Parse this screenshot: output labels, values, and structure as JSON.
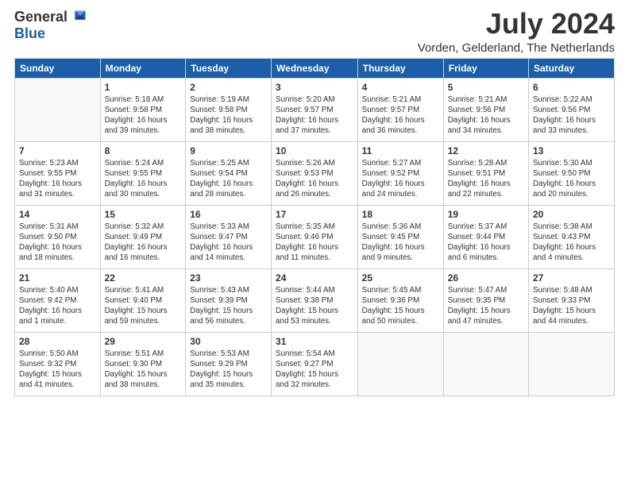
{
  "logo": {
    "general": "General",
    "blue": "Blue"
  },
  "title": "July 2024",
  "location": "Vorden, Gelderland, The Netherlands",
  "weekdays": [
    "Sunday",
    "Monday",
    "Tuesday",
    "Wednesday",
    "Thursday",
    "Friday",
    "Saturday"
  ],
  "weeks": [
    [
      {
        "day": "",
        "info": ""
      },
      {
        "day": "1",
        "info": "Sunrise: 5:18 AM\nSunset: 9:58 PM\nDaylight: 16 hours\nand 39 minutes."
      },
      {
        "day": "2",
        "info": "Sunrise: 5:19 AM\nSunset: 9:58 PM\nDaylight: 16 hours\nand 38 minutes."
      },
      {
        "day": "3",
        "info": "Sunrise: 5:20 AM\nSunset: 9:57 PM\nDaylight: 16 hours\nand 37 minutes."
      },
      {
        "day": "4",
        "info": "Sunrise: 5:21 AM\nSunset: 9:57 PM\nDaylight: 16 hours\nand 36 minutes."
      },
      {
        "day": "5",
        "info": "Sunrise: 5:21 AM\nSunset: 9:56 PM\nDaylight: 16 hours\nand 34 minutes."
      },
      {
        "day": "6",
        "info": "Sunrise: 5:22 AM\nSunset: 9:56 PM\nDaylight: 16 hours\nand 33 minutes."
      }
    ],
    [
      {
        "day": "7",
        "info": "Sunrise: 5:23 AM\nSunset: 9:55 PM\nDaylight: 16 hours\nand 31 minutes."
      },
      {
        "day": "8",
        "info": "Sunrise: 5:24 AM\nSunset: 9:55 PM\nDaylight: 16 hours\nand 30 minutes."
      },
      {
        "day": "9",
        "info": "Sunrise: 5:25 AM\nSunset: 9:54 PM\nDaylight: 16 hours\nand 28 minutes."
      },
      {
        "day": "10",
        "info": "Sunrise: 5:26 AM\nSunset: 9:53 PM\nDaylight: 16 hours\nand 26 minutes."
      },
      {
        "day": "11",
        "info": "Sunrise: 5:27 AM\nSunset: 9:52 PM\nDaylight: 16 hours\nand 24 minutes."
      },
      {
        "day": "12",
        "info": "Sunrise: 5:28 AM\nSunset: 9:51 PM\nDaylight: 16 hours\nand 22 minutes."
      },
      {
        "day": "13",
        "info": "Sunrise: 5:30 AM\nSunset: 9:50 PM\nDaylight: 16 hours\nand 20 minutes."
      }
    ],
    [
      {
        "day": "14",
        "info": "Sunrise: 5:31 AM\nSunset: 9:50 PM\nDaylight: 16 hours\nand 18 minutes."
      },
      {
        "day": "15",
        "info": "Sunrise: 5:32 AM\nSunset: 9:49 PM\nDaylight: 16 hours\nand 16 minutes."
      },
      {
        "day": "16",
        "info": "Sunrise: 5:33 AM\nSunset: 9:47 PM\nDaylight: 16 hours\nand 14 minutes."
      },
      {
        "day": "17",
        "info": "Sunrise: 5:35 AM\nSunset: 9:46 PM\nDaylight: 16 hours\nand 11 minutes."
      },
      {
        "day": "18",
        "info": "Sunrise: 5:36 AM\nSunset: 9:45 PM\nDaylight: 16 hours\nand 9 minutes."
      },
      {
        "day": "19",
        "info": "Sunrise: 5:37 AM\nSunset: 9:44 PM\nDaylight: 16 hours\nand 6 minutes."
      },
      {
        "day": "20",
        "info": "Sunrise: 5:38 AM\nSunset: 9:43 PM\nDaylight: 16 hours\nand 4 minutes."
      }
    ],
    [
      {
        "day": "21",
        "info": "Sunrise: 5:40 AM\nSunset: 9:42 PM\nDaylight: 16 hours\nand 1 minute."
      },
      {
        "day": "22",
        "info": "Sunrise: 5:41 AM\nSunset: 9:40 PM\nDaylight: 15 hours\nand 59 minutes."
      },
      {
        "day": "23",
        "info": "Sunrise: 5:43 AM\nSunset: 9:39 PM\nDaylight: 15 hours\nand 56 minutes."
      },
      {
        "day": "24",
        "info": "Sunrise: 5:44 AM\nSunset: 9:38 PM\nDaylight: 15 hours\nand 53 minutes."
      },
      {
        "day": "25",
        "info": "Sunrise: 5:45 AM\nSunset: 9:36 PM\nDaylight: 15 hours\nand 50 minutes."
      },
      {
        "day": "26",
        "info": "Sunrise: 5:47 AM\nSunset: 9:35 PM\nDaylight: 15 hours\nand 47 minutes."
      },
      {
        "day": "27",
        "info": "Sunrise: 5:48 AM\nSunset: 9:33 PM\nDaylight: 15 hours\nand 44 minutes."
      }
    ],
    [
      {
        "day": "28",
        "info": "Sunrise: 5:50 AM\nSunset: 9:32 PM\nDaylight: 15 hours\nand 41 minutes."
      },
      {
        "day": "29",
        "info": "Sunrise: 5:51 AM\nSunset: 9:30 PM\nDaylight: 15 hours\nand 38 minutes."
      },
      {
        "day": "30",
        "info": "Sunrise: 5:53 AM\nSunset: 9:29 PM\nDaylight: 15 hours\nand 35 minutes."
      },
      {
        "day": "31",
        "info": "Sunrise: 5:54 AM\nSunset: 9:27 PM\nDaylight: 15 hours\nand 32 minutes."
      },
      {
        "day": "",
        "info": ""
      },
      {
        "day": "",
        "info": ""
      },
      {
        "day": "",
        "info": ""
      }
    ]
  ]
}
